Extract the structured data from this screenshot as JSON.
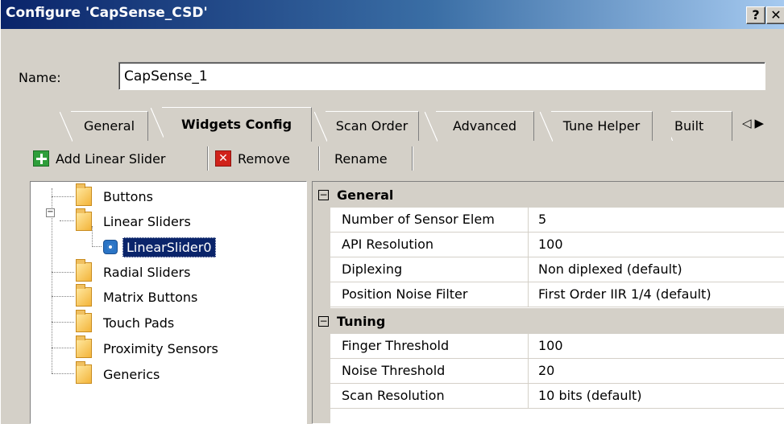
{
  "window": {
    "title": "Configure 'CapSense_CSD'",
    "help_glyph": "?",
    "close_glyph": "✕"
  },
  "name_field": {
    "label": "Name:",
    "value": "CapSense_1"
  },
  "tabs": [
    {
      "label": "General"
    },
    {
      "label": "Widgets Config",
      "active": true
    },
    {
      "label": "Scan Order"
    },
    {
      "label": "Advanced"
    },
    {
      "label": "Tune Helper"
    },
    {
      "label": "Built"
    }
  ],
  "tab_scroll": {
    "left_glyph": "◁",
    "right_glyph": "▶"
  },
  "toolbar": {
    "add_label": "Add Linear Slider",
    "remove_label": "Remove",
    "rename_label": "Rename",
    "add_icon": "plus-icon",
    "remove_icon": "x-icon"
  },
  "tree": {
    "items": [
      {
        "label": "Buttons",
        "icon": "folder-icon"
      },
      {
        "label": "Linear Sliders",
        "icon": "folder-icon",
        "expanded": true
      },
      {
        "label": "LinearSlider0",
        "icon": "gear-icon",
        "selected": true
      },
      {
        "label": "Radial Sliders",
        "icon": "folder-icon"
      },
      {
        "label": "Matrix Buttons",
        "icon": "folder-icon"
      },
      {
        "label": "Touch Pads",
        "icon": "folder-icon"
      },
      {
        "label": "Proximity Sensors",
        "icon": "folder-icon"
      },
      {
        "label": "Generics",
        "icon": "folder-icon"
      }
    ],
    "expander_glyph": "−"
  },
  "properties": {
    "categories": [
      {
        "label": "General",
        "toggle": "−",
        "rows": [
          {
            "name": "Number of Sensor Elem",
            "value": "5"
          },
          {
            "name": "API Resolution",
            "value": "100"
          },
          {
            "name": "Diplexing",
            "value": "Non diplexed (default)"
          },
          {
            "name": "Position Noise Filter",
            "value": "First Order IIR 1/4 (default)"
          }
        ]
      },
      {
        "label": "Tuning",
        "toggle": "−",
        "rows": [
          {
            "name": "Finger Threshold",
            "value": "100"
          },
          {
            "name": "Noise Threshold",
            "value": "20"
          },
          {
            "name": "Scan Resolution",
            "value": "10 bits (default)"
          }
        ]
      }
    ]
  },
  "colors": {
    "title_bar_start": "#0a246a",
    "title_bar_end": "#a6caf0",
    "dialog_face": "#d4d0c8",
    "selection": "#0a246a"
  }
}
